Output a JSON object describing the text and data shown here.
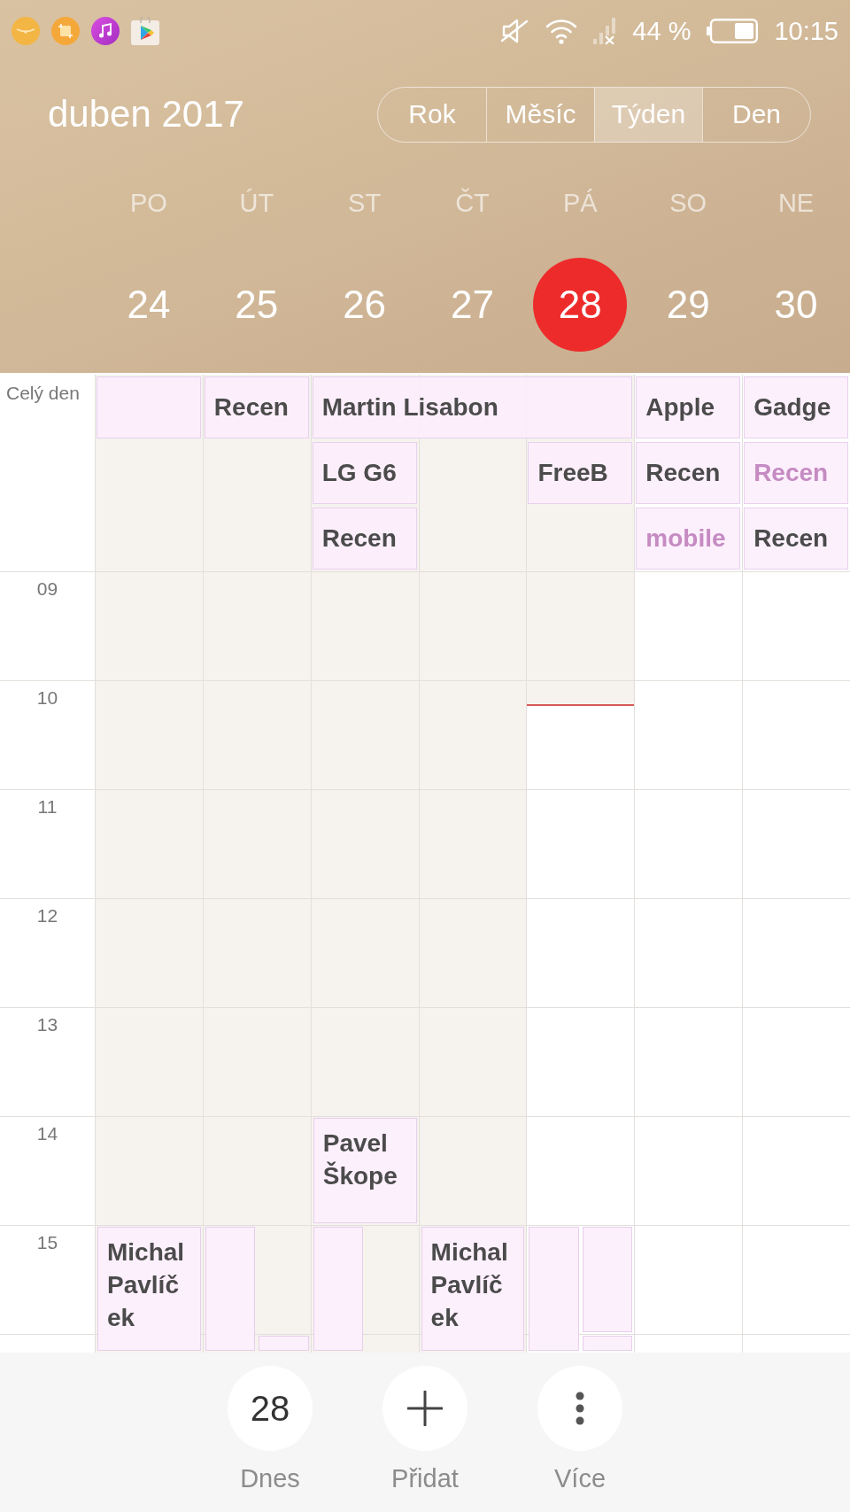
{
  "status_bar": {
    "battery": "44 %",
    "time": "10:15"
  },
  "header": {
    "title": "duben 2017",
    "view_tabs": [
      {
        "label": "Rok",
        "selected": false
      },
      {
        "label": "Měsíc",
        "selected": false
      },
      {
        "label": "Týden",
        "selected": true
      },
      {
        "label": "Den",
        "selected": false
      }
    ]
  },
  "days": [
    {
      "weekday": "PO",
      "date": "24",
      "selected": false,
      "past": true
    },
    {
      "weekday": "ÚT",
      "date": "25",
      "selected": false,
      "past": true
    },
    {
      "weekday": "ST",
      "date": "26",
      "selected": false,
      "past": true
    },
    {
      "weekday": "ČT",
      "date": "27",
      "selected": false,
      "past": true
    },
    {
      "weekday": "PÁ",
      "date": "28",
      "selected": true,
      "past": false,
      "elapsed": {
        "level": 0.17
      }
    },
    {
      "weekday": "SO",
      "date": "29",
      "selected": false,
      "past": false
    },
    {
      "weekday": "NE",
      "date": "30",
      "selected": false,
      "past": false
    }
  ],
  "all_day": {
    "label": "Celý den",
    "rows": [
      {
        "slots": [
          {
            "kind": "event"
          },
          {
            "kind": "event",
            "title": "Recen",
            "faded": false
          },
          {
            "kind": "event",
            "title": "Martin Lisabon",
            "faded": false
          },
          {
            "kind": "continued"
          },
          {
            "kind": "continued"
          },
          {
            "kind": "event",
            "title": "Apple",
            "faded": false
          },
          {
            "kind": "event",
            "title": "Gadge",
            "faded": false
          }
        ]
      },
      {
        "slots": [
          {
            "kind": "empty"
          },
          {
            "kind": "empty"
          },
          {
            "kind": "event",
            "title": "LG G6",
            "faded": false
          },
          {
            "kind": "empty"
          },
          {
            "kind": "event",
            "title": "FreeB",
            "faded": false
          },
          {
            "kind": "event",
            "title": "Recen",
            "faded": false
          },
          {
            "kind": "event",
            "title": "Recen",
            "faded": true
          }
        ]
      },
      {
        "slots": [
          {
            "kind": "empty"
          },
          {
            "kind": "empty"
          },
          {
            "kind": "event",
            "title": "Recen",
            "faded": false
          },
          {
            "kind": "empty"
          },
          {
            "kind": "empty"
          },
          {
            "kind": "event",
            "title": "mobile",
            "faded": true
          },
          {
            "kind": "event",
            "title": "Recen",
            "faded": false
          }
        ]
      }
    ]
  },
  "hours": [
    {
      "label": "09"
    },
    {
      "label": "10"
    },
    {
      "label": "11"
    },
    {
      "label": "12"
    },
    {
      "label": "13"
    },
    {
      "label": "14",
      "slots": [
        {
          "kind": "free"
        },
        {
          "kind": "free"
        },
        {
          "kind": "booked",
          "events": [
            {
              "kind": "full",
              "title": "Pavel Škope",
              "continues": false
            }
          ]
        },
        {
          "kind": "free"
        },
        {
          "kind": "free"
        },
        {
          "kind": "free"
        },
        {
          "kind": "free"
        }
      ]
    },
    {
      "label": "15",
      "slots": [
        {
          "kind": "booked",
          "events": [
            {
              "kind": "full",
              "title": "Michal Pavlíček",
              "continues": true
            }
          ]
        },
        {
          "kind": "booked",
          "events": [
            {
              "kind": "left",
              "continues": true
            }
          ]
        },
        {
          "kind": "booked",
          "events": [
            {
              "kind": "left",
              "continues": true
            }
          ]
        },
        {
          "kind": "booked",
          "events": [
            {
              "kind": "full",
              "title": "Michal Pavlíček",
              "continues": true
            }
          ]
        },
        {
          "kind": "booked",
          "events": [
            {
              "kind": "left",
              "continues": true
            },
            {
              "kind": "right",
              "continues": false
            }
          ]
        },
        {
          "kind": "free"
        },
        {
          "kind": "free"
        }
      ]
    },
    {
      "slots": [
        {
          "kind": "free"
        },
        {
          "kind": "booked",
          "events": [
            {
              "kind": "right"
            }
          ]
        },
        {
          "kind": "free"
        },
        {
          "kind": "free"
        },
        {
          "kind": "booked",
          "events": [
            {
              "kind": "right"
            }
          ]
        },
        {
          "kind": "free"
        },
        {
          "kind": "free"
        }
      ]
    }
  ],
  "bottom_bar": {
    "actions": [
      {
        "kind": "today",
        "label": "Dnes",
        "date": "28"
      },
      {
        "kind": "add",
        "label": "Přidat"
      },
      {
        "kind": "more",
        "label": "Více"
      }
    ]
  }
}
